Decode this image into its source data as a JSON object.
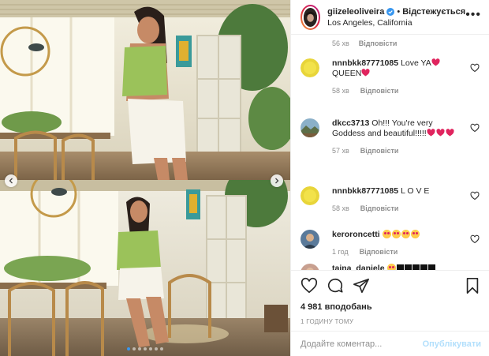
{
  "header": {
    "username": "giizeleoliveira",
    "verified_icon": "verified-badge-icon",
    "separator": "•",
    "follow_status": "Відстежується",
    "location": "Los Angeles, California",
    "more_icon": "more-options-icon"
  },
  "comments_top_meta": {
    "time": "56 хв",
    "reply": "Відповісти"
  },
  "comments": [
    {
      "user": "nnnbkk87771085",
      "segments": [
        {
          "text": "Love YA"
        },
        {
          "emoji": "red-heart"
        },
        {
          "text": " QUEEN"
        },
        {
          "emoji": "red-heart"
        }
      ],
      "time": "58 хв",
      "reply": "Відповісти",
      "avatar": "yellow-circle-avatar"
    },
    {
      "user": "dkcc3713",
      "segments": [
        {
          "text": "Oh!!! You're very Goddess and beautiful!!!!!"
        },
        {
          "emoji": "red-heart"
        },
        {
          "emoji": "red-heart"
        },
        {
          "emoji": "red-heart"
        }
      ],
      "time": "57 хв",
      "reply": "Відповісти",
      "avatar": "landscape-avatar"
    },
    {
      "user": "nnnbkk87771085",
      "segments": [
        {
          "text": "L O V E"
        }
      ],
      "time": "58 хв",
      "reply": "Відповісти",
      "avatar": "yellow-circle-avatar"
    },
    {
      "user": "keroroncetti",
      "segments": [
        {
          "emoji": "heart-eyes"
        },
        {
          "emoji": "heart-eyes"
        },
        {
          "emoji": "heart-eyes"
        },
        {
          "emoji": "heart-eyes"
        }
      ],
      "time": "1 год",
      "reply": "Відповісти",
      "avatar": "person-avatar"
    },
    {
      "user": "taina_daniele",
      "segments": [
        {
          "emoji": "heart-eyes"
        },
        {
          "emoji": "black-square"
        },
        {
          "emoji": "black-square"
        },
        {
          "emoji": "black-square"
        },
        {
          "emoji": "black-square"
        },
        {
          "emoji": "black-square"
        }
      ],
      "time": "",
      "reply": "",
      "avatar": "person-avatar-2"
    }
  ],
  "actions": {
    "like_icon": "heart-outline-icon",
    "comment_icon": "comment-bubble-icon",
    "share_icon": "paper-plane-icon",
    "save_icon": "bookmark-icon"
  },
  "likes": "4 981 вподобань",
  "time_ago": "1 ГОДИНУ ТОМУ",
  "add_comment": {
    "placeholder": "Додайте коментар...",
    "publish_label": "Опублікувати"
  },
  "carousel": {
    "prev_icon": "chevron-left-icon",
    "next_icon": "chevron-right-icon",
    "slide_count": 7,
    "active_slide": 1
  },
  "colors": {
    "link_blue": "#3897f0",
    "publish_disabled": "#b2dffc",
    "meta_gray": "#8e8e8e",
    "heart_red": "#ed4956"
  }
}
